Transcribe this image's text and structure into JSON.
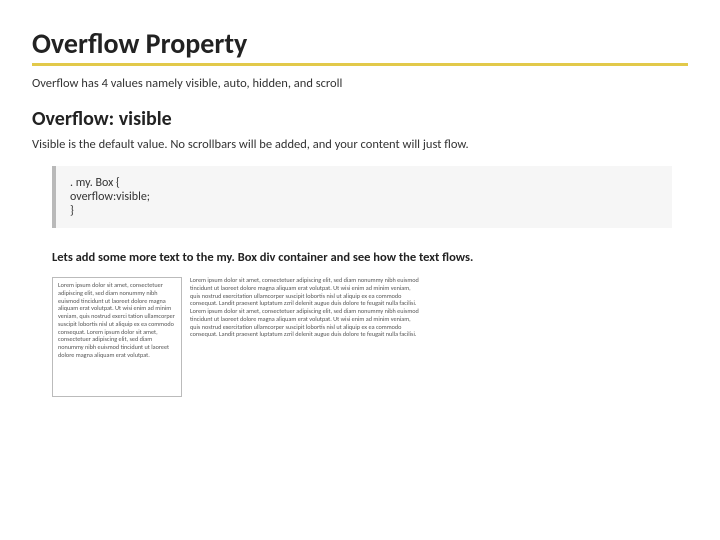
{
  "heading_main": "Overflow Property",
  "intro": "Overflow has 4 values namely visible, auto, hidden, and scroll",
  "heading_sub": "Overflow: visible",
  "desc": "Visible is the default value. No scrollbars will be added, and your content will just flow.",
  "code": ". my. Box {\noverflow:visible;\n}",
  "bold_line": "Lets add some more text to the my. Box div container and see how the text flows.",
  "lorem_box": "Lorem ipsum dolor sit amet, consectetuer adipiscing elit, sed diam nonummy nibh euismod tincidunt ut laoreet dolore magna aliquam erat volutpat. Ut wisi enim ad minim veniam, quis nostrud exerci tation ullamcorper suscipit lobortis nisl ut aliquip ex ea commodo consequat. Lorem ipsum dolor sit amet, consectetuer adipiscing elit, sed diam nonummy nibh euismod tincidunt ut laoreet dolore magna aliquam erat volutpat.",
  "lorem_side": "Lorem ipsum dolor sit amet, consectetuer adipiscing elit, sed diam nonummy nibh euismod tincidunt ut laoreet dolore magna aliquam erat volutpat. Ut wisi enim ad minim veniam, quis nostrud exercitation ullamcorper suscipit lobortis nisl ut aliquip ex ea commodo consequat. Landit praesent luptatum zzril delenit augue duis dolore te feugait nulla facilisi. Lorem ipsum dolor sit amet, consectetuer adipiscing elit, sed diam nonummy nibh euismod tincidunt ut laoreet dolore magna aliquam erat volutpat. Ut wisi enim ad minim veniam, quis nostrud exercitation ullamcorper suscipit lobortis nisl ut aliquip ex ea commodo consequat. Landit praesent luptatum zzril delenit augue duis dolore te feugait nulla facilisi."
}
